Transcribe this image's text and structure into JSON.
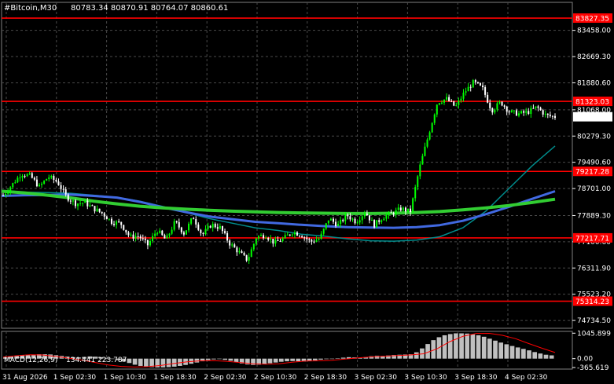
{
  "header": {
    "symbol_title": "#Bitcoin,M30",
    "ohlc": "80783.34 80870.91 80764.07 80860.61"
  },
  "colors": {
    "background": "#000000",
    "grid": "#4a4a4a",
    "bull_candle": "#00ff00",
    "bear_candle": "#ffffff",
    "level_line": "#ff0000",
    "level_tag_bg": "#ff0000",
    "ma_fast": "#008b8b",
    "ma_mid": "#4169e1",
    "ma_slow": "#32cd32",
    "price_tag_bg": "#ffffff",
    "macd_hist": "#c0c0c0",
    "macd_signal": "#ff0000"
  },
  "chart_data": [
    {
      "type": "candlestick",
      "title": "#Bitcoin,M30",
      "y_ticks": [
        "83458.00",
        "82669.30",
        "81880.60",
        "81068.00",
        "80279.30",
        "79490.60",
        "78701.00",
        "77889.30",
        "77100.60",
        "76311.90",
        "75523.20",
        "74734.50"
      ],
      "ylim": [
        74500,
        84300
      ],
      "x_ticks": [
        "31 Aug 2026",
        "1 Sep 02:30",
        "1 Sep 10:30",
        "1 Sep 18:30",
        "2 Sep 02:30",
        "2 Sep 10:30",
        "2 Sep 18:30",
        "3 Sep 02:30",
        "3 Sep 10:30",
        "3 Sep 18:30",
        "4 Sep 02:30"
      ],
      "last_price": 80860.61,
      "levels": [
        {
          "label": "83827.35",
          "value": 83827.35
        },
        {
          "label": "81323.03",
          "value": 81323.03
        },
        {
          "label": "79217.28",
          "value": 79217.28
        },
        {
          "label": "77217.71",
          "value": 77217.71
        },
        {
          "label": "75314.23",
          "value": 75314.23
        }
      ],
      "moving_averages": [
        {
          "color": "#008b8b",
          "y": [
            78650,
            78590,
            78580,
            78560,
            78500,
            78440,
            78320,
            78160,
            77980,
            77800,
            77660,
            77520,
            77440,
            77330,
            77270,
            77190,
            77130,
            77120,
            77150,
            77250,
            77520,
            78020,
            78700,
            79380,
            79980
          ]
        },
        {
          "color": "#4169e1",
          "y": [
            78480,
            78500,
            78510,
            78520,
            78480,
            78430,
            78300,
            78140,
            77990,
            77860,
            77780,
            77700,
            77660,
            77610,
            77570,
            77540,
            77530,
            77520,
            77540,
            77600,
            77730,
            77930,
            78150,
            78390,
            78620
          ]
        },
        {
          "color": "#32cd32",
          "y": [
            78620,
            78570,
            78500,
            78420,
            78320,
            78240,
            78170,
            78120,
            78080,
            78050,
            78020,
            78000,
            77980,
            77970,
            77960,
            77950,
            77950,
            77960,
            77980,
            78010,
            78060,
            78120,
            78190,
            78280,
            78380
          ]
        }
      ],
      "price_path": [
        78500,
        78820,
        79150,
        79080,
        78750,
        79060,
        78900,
        78450,
        78250,
        78280,
        78100,
        77950,
        77700,
        77650,
        77250,
        77270,
        77000,
        77450,
        77150,
        77700,
        77350,
        77850,
        77300,
        77620,
        77520,
        77060,
        76800,
        76550,
        77250,
        77300,
        77060,
        77200,
        77400,
        77300,
        77100,
        77200,
        77800,
        77600,
        77900,
        77700,
        78000,
        77600,
        77850,
        77950,
        78100,
        78000,
        79300,
        80300,
        81300,
        81400,
        81150,
        81600,
        81900,
        81700,
        81050,
        81300,
        81000,
        80950,
        81000,
        81150,
        80900,
        80860
      ]
    },
    {
      "type": "bar",
      "title": "MACD(12,26,9)",
      "indicator_values": "134.441 223.787",
      "y_ticks": [
        "1045.899",
        "0.00",
        "-365.619"
      ],
      "ylim": [
        -430,
        1120
      ],
      "histogram": [
        50,
        80,
        110,
        140,
        160,
        170,
        180,
        180,
        170,
        140,
        110,
        80,
        60,
        50,
        70,
        90,
        80,
        60,
        30,
        -10,
        -60,
        -120,
        -180,
        -250,
        -300,
        -330,
        -350,
        -360,
        -360,
        -350,
        -330,
        -300,
        -260,
        -210,
        -160,
        -110,
        -60,
        -30,
        -20,
        -50,
        -90,
        -150,
        -200,
        -240,
        -260,
        -250,
        -220,
        -190,
        -160,
        -130,
        -110,
        -100,
        -110,
        -120,
        -100,
        -70,
        -40,
        -20,
        -10,
        10,
        40,
        60,
        50,
        30,
        60,
        100,
        120,
        110,
        130,
        150,
        160,
        170,
        180,
        260,
        420,
        600,
        760,
        880,
        960,
        1010,
        1040,
        1040,
        1030,
        1000,
        960,
        900,
        820,
        740,
        660,
        590,
        520,
        460,
        400,
        340,
        270,
        210,
        160,
        134
      ],
      "signal": [
        60,
        120,
        160,
        150,
        90,
        20,
        -60,
        -160,
        -260,
        -320,
        -345,
        -330,
        -280,
        -200,
        -130,
        -90,
        -80,
        -110,
        -160,
        -210,
        -230,
        -210,
        -150,
        -100,
        -90,
        -70,
        -20,
        30,
        70,
        100,
        130,
        150,
        200,
        400,
        700,
        920,
        1035,
        1040,
        960,
        820,
        620,
        430,
        250
      ]
    }
  ]
}
